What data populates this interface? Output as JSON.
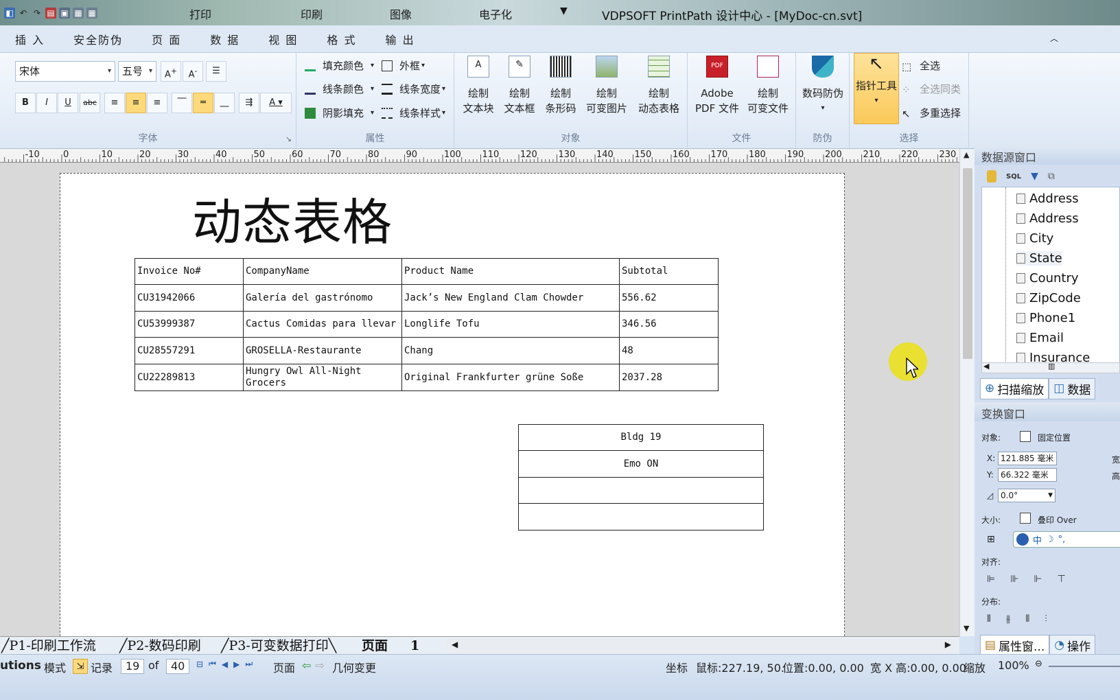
{
  "app": {
    "title": "VDPSOFT PrintPath 设计中心 - [MyDoc-cn.svt]",
    "quick_access": [
      "打印",
      "印刷",
      "图像",
      "电子化"
    ]
  },
  "menu": [
    "插 入",
    "安全防伪",
    "页 面",
    "数 据",
    "视 图",
    "格 式",
    "输 出"
  ],
  "ribbon": {
    "font": {
      "label": "字体",
      "family": "宋体",
      "size": "五号",
      "buttons": [
        "B",
        "I",
        "U",
        "abc",
        "A"
      ]
    },
    "attributes": {
      "label": "属性",
      "items": [
        "填充颜色",
        "线条颜色",
        "阴影填充",
        "外框",
        "线条宽度",
        "线条样式"
      ]
    },
    "objects": {
      "label": "对象",
      "items": [
        {
          "top": "绘制",
          "bottom": "文本块"
        },
        {
          "top": "绘制",
          "bottom": "文本框"
        },
        {
          "top": "绘制",
          "bottom": "条形码"
        },
        {
          "top": "绘制",
          "bottom": "可变图片"
        },
        {
          "top": "绘制",
          "bottom": "动态表格"
        }
      ]
    },
    "file": {
      "label": "文件",
      "items": [
        {
          "top": "Adobe",
          "bottom": "PDF 文件"
        },
        {
          "top": "绘制",
          "bottom": "可变文件"
        }
      ]
    },
    "anticounterfeit": {
      "label": "防伪",
      "button": "数码防伪"
    },
    "select": {
      "label": "选择",
      "pointer": "指针工具",
      "items": [
        "全选",
        "全选同类",
        "多重选择"
      ]
    }
  },
  "ruler": {
    "labels": [
      "-10",
      "0",
      "10",
      "20",
      "30",
      "40",
      "50",
      "60",
      "70",
      "80",
      "90",
      "100",
      "110",
      "120",
      "130",
      "140",
      "150",
      "160",
      "170",
      "180",
      "190",
      "200",
      "210",
      "220",
      "230"
    ]
  },
  "document": {
    "title": "动态表格",
    "table": {
      "headers": [
        "Invoice No#",
        "CompanyName",
        "Product Name",
        "Subtotal"
      ],
      "rows": [
        [
          "CU31942066",
          "Galería del gastrónomo",
          "Jack’s New England Clam Chowder",
          "556.62"
        ],
        [
          "CU53999387",
          "Cactus Comidas para llevar",
          "Longlife Tofu",
          "346.56"
        ],
        [
          "CU28557291",
          "GROSELLA-Restaurante",
          "Chang",
          "48"
        ],
        [
          "CU22289813",
          "Hungry Owl All-Night Grocers",
          "Original Frankfurter grüne Soße",
          "2037.28"
        ]
      ]
    },
    "address_box": [
      "Bldg 19",
      "Emo ON",
      "",
      ""
    ]
  },
  "datasource": {
    "title": "数据源窗口",
    "fields": [
      "Address",
      "Address",
      "City",
      "State",
      "Country",
      "ZipCode",
      "Phone1",
      "Email",
      "Insurance"
    ],
    "tabs": [
      "扫描缩放",
      "数据"
    ]
  },
  "transform": {
    "title": "变换窗口",
    "object_label": "对象:",
    "fixed_position": "固定位置",
    "x_label": "X:",
    "x_value": "121.885 毫米",
    "w_label": "宽",
    "y_label": "Y:",
    "y_value": "66.322 毫米",
    "h_label": "高",
    "angle": "0.0°",
    "size_label": "大小:",
    "overprint": "叠印 Over",
    "align_label": "对齐:",
    "distribute_label": "分布:",
    "tabs": [
      "属性窗...",
      "操作"
    ]
  },
  "sheet_tabs": [
    "P1-印刷工作流",
    "P2-数码印刷",
    "P3-可变数据打印",
    "页面",
    "1"
  ],
  "status": {
    "left_cut": "utions",
    "mode": "模式",
    "record_label": "记录",
    "record_value": "19",
    "of": "of",
    "total": "40",
    "page": "页面",
    "geometry": "几何变更",
    "coord_label": "坐标",
    "mouse": "鼠标:227.19, 50.",
    "position": "位置:0.00, 0.00",
    "size": "宽 X 高:0.00, 0.00",
    "zoom_label": "缩放",
    "zoom": "100%"
  },
  "colors": {
    "accent": "#fbc95a",
    "ribbon": "#dde8f5",
    "pane": "#d2def0"
  }
}
